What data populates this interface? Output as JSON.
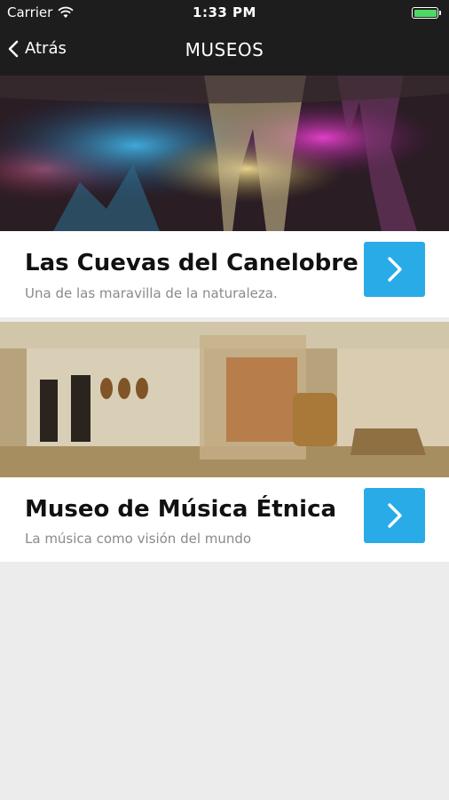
{
  "status_bar": {
    "carrier": "Carrier",
    "time": "1:33 PM"
  },
  "nav": {
    "back_label": "Atrás",
    "title": "MUSEOS"
  },
  "museums": [
    {
      "title": "Las Cuevas del Canelobre",
      "subtitle": "Una de las maravilla de la naturaleza."
    },
    {
      "title": "Museo de Música Étnica",
      "subtitle": "La música como visión del mundo"
    }
  ],
  "colors": {
    "header_bg": "#1d1d1d",
    "accent_button": "#29abe8",
    "battery": "#4cd964",
    "page_bg": "#ececec"
  },
  "icons": {
    "back": "chevron-left-icon",
    "go": "chevron-right-icon",
    "wifi": "wifi-icon",
    "battery": "battery-icon"
  }
}
